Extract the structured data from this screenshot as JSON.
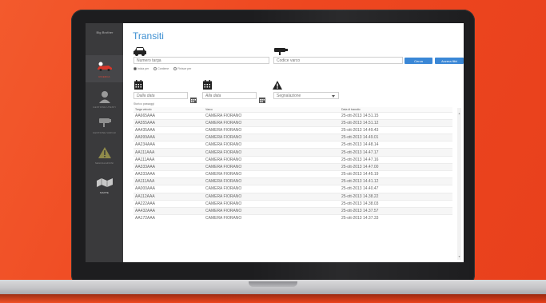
{
  "app": {
    "brand": "Big Brother",
    "page_title": "Transiti"
  },
  "sidebar": {
    "items": [
      {
        "label": "RICERCA",
        "icon": "car-icon",
        "active": true
      },
      {
        "label": "GESTIONE UTENTI",
        "icon": "user-icon",
        "active": false
      },
      {
        "label": "GESTIONE VARCHI",
        "icon": "camera-icon",
        "active": false
      },
      {
        "label": "SEGNALAZIONI",
        "icon": "warning-icon",
        "active": false
      },
      {
        "label": "MAPPE",
        "icon": "map-icon",
        "active": false
      }
    ]
  },
  "filters": {
    "plate_placeholder": "Numero targa",
    "gate_placeholder": "Codice varco",
    "search_label": "Cerca",
    "reset_label": "Azzera filtri",
    "radio": [
      {
        "label": "Inizia per",
        "checked": true
      },
      {
        "label": "Contiene",
        "checked": false
      },
      {
        "label": "Finisce per",
        "checked": false
      }
    ],
    "from_placeholder": "Dalla data",
    "to_placeholder": "Alla data",
    "report_placeholder": "Segnalazione",
    "history_label": "Storico passaggi"
  },
  "table": {
    "headers": [
      "Targa veicolo",
      "Varco",
      "Data di transito"
    ],
    "rows": [
      [
        "AA665AAA",
        "CAMERA FIORANO",
        "25-ott-2013 14.51.15"
      ],
      [
        "AA555AAA",
        "CAMERA FIORANO",
        "25-ott-2013 14.51.12"
      ],
      [
        "AA435AAA",
        "CAMERA FIORANO",
        "25-ott-2013 14.49.43"
      ],
      [
        "AA999AAA",
        "CAMERA FIORANO",
        "25-ott-2013 14.49.01"
      ],
      [
        "AA234AAA",
        "CAMERA FIORANO",
        "25-ott-2013 14.48.14"
      ],
      [
        "AA111AAA",
        "CAMERA FIORANO",
        "25-ott-2013 14.47.17"
      ],
      [
        "AA111AAA",
        "CAMERA FIORANO",
        "25-ott-2013 14.47.16"
      ],
      [
        "AA333AAA",
        "CAMERA FIORANO",
        "25-ott-2013 14.47.00"
      ],
      [
        "AA333AAA",
        "CAMERA FIORANO",
        "25-ott-2013 14.45.19"
      ],
      [
        "AA111AAA",
        "CAMERA FIORANO",
        "25-ott-2013 14.41.12"
      ],
      [
        "AA000AAA",
        "CAMERA FIORANO",
        "25-ott-2013 14.40.47"
      ],
      [
        "AA112AAA",
        "CAMERA FIORANO",
        "25-ott-2013 14.38.22"
      ],
      [
        "AA222AAA",
        "CAMERA FIORANO",
        "25-ott-2013 14.38.03"
      ],
      [
        "AA432AAA",
        "CAMERA FIORANO",
        "25-ott-2013 14.37.57"
      ],
      [
        "AA172AAA",
        "CAMERA FIORANO",
        "25-ott-2013 14.37.33"
      ]
    ]
  },
  "colors": {
    "background": "#f0441f",
    "accent": "#3a87d6",
    "active_nav": "#e04a3a",
    "sidebar": "#3a3a3c"
  }
}
